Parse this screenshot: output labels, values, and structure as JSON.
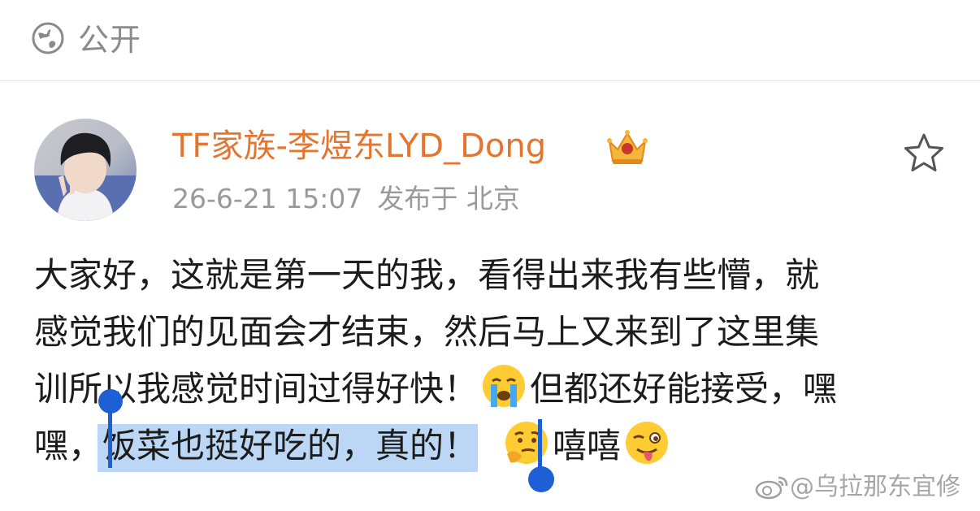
{
  "header": {
    "visibility_icon": "globe-icon",
    "visibility_label": "公开"
  },
  "post": {
    "author": {
      "name": "TF家族-李煜东LYD_Dong",
      "badge_icon": "crown-badge-icon",
      "avatar": "avatar-image"
    },
    "meta": {
      "time": "26-6-21 15:07",
      "location": "发布于 北京"
    },
    "favorite_icon": "star-outline-icon",
    "body": {
      "line1": "大家好，这就是第一天的我，看得出来我有些懵，就",
      "line2": "感觉我们的见面会才结束，然后马上又来到了这里集",
      "line3_before": "训所以我感觉时间过得好快！",
      "line3_after": "但都还好能接受，嘿",
      "line4_before": "嘿，",
      "selected_text": "饭菜也挺好吃的，真的！",
      "line4_after": "嘻嘻",
      "emojis": [
        "crying-face-emoji",
        "thinking-face-emoji",
        "winking-tongue-emoji"
      ]
    }
  },
  "watermark": {
    "icon": "weibo-logo-icon",
    "text": "@乌拉那东宜修"
  },
  "colors": {
    "author": "#e4752f",
    "selection": "#bcd7f5",
    "handle": "#1f5fd6",
    "muted": "#9a9a9a"
  }
}
